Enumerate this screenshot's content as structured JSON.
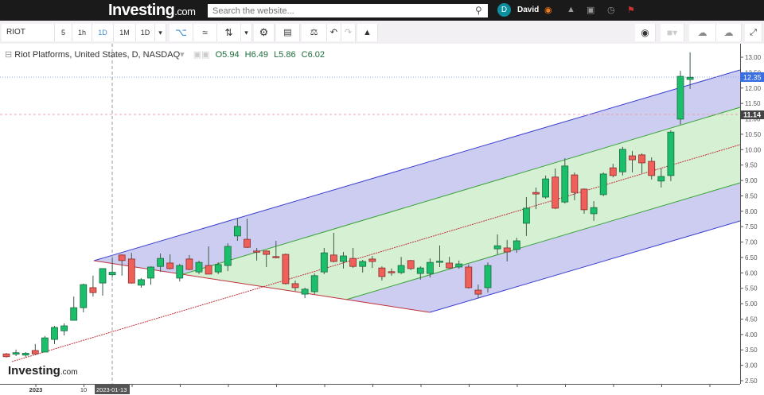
{
  "header": {
    "logo": "Investing",
    "logo_suffix": ".com",
    "search_placeholder": "Search the website...",
    "user_initial": "D",
    "user_name": "David"
  },
  "toolbar": {
    "symbol": "RIOT",
    "intervals": [
      "5",
      "1h",
      "1D",
      "1M",
      "1D"
    ],
    "active_interval": "1D"
  },
  "legend": {
    "title": "Riot Platforms, United States, D, NASDAQ",
    "open": "O5.94",
    "high": "H6.49",
    "low": "L5.86",
    "close": "C6.02"
  },
  "watermark": {
    "logo": "Investing",
    "suffix": ".com"
  },
  "colors": {
    "up": "#1bbf6b",
    "down": "#f0605a",
    "blue_band": "#c7c8ee",
    "green_band": "#d6f0d3",
    "last_price": "#3a6fe0"
  },
  "chart_data": {
    "type": "candlestick",
    "title": "Riot Platforms, United States, D, NASDAQ",
    "ylim": [
      2.5,
      13.0
    ],
    "y_ticks": [
      "13.00",
      "12.50",
      "12.00",
      "11.50",
      "11.00",
      "10.50",
      "10.00",
      "9.50",
      "9.00",
      "8.50",
      "8.00",
      "7.50",
      "7.00",
      "6.50",
      "6.00",
      "5.50",
      "5.00",
      "4.50",
      "4.00",
      "3.50",
      "3.00",
      "2.50"
    ],
    "x_labels": [
      "2023",
      "10"
    ],
    "crosshair_date": "2023-01-13",
    "last_price_label": "12.35",
    "marker_price_label": "11.14",
    "ohlc": [
      [
        3.37,
        3.4,
        3.25,
        3.28
      ],
      [
        3.36,
        3.51,
        3.3,
        3.41
      ],
      [
        3.33,
        3.43,
        3.27,
        3.39
      ],
      [
        3.48,
        3.69,
        3.33,
        3.37
      ],
      [
        3.43,
        3.95,
        3.43,
        3.89
      ],
      [
        3.84,
        4.28,
        3.69,
        4.23
      ],
      [
        4.12,
        4.36,
        3.97,
        4.28
      ],
      [
        4.46,
        5.23,
        4.46,
        4.87
      ],
      [
        4.87,
        5.65,
        4.72,
        5.62
      ],
      [
        5.52,
        5.91,
        5.23,
        5.36
      ],
      [
        5.67,
        6.14,
        5.26,
        6.14
      ],
      [
        5.94,
        6.49,
        5.86,
        6.02
      ],
      [
        6.58,
        6.6,
        5.91,
        6.4
      ],
      [
        6.45,
        6.65,
        5.65,
        5.67
      ],
      [
        5.6,
        5.83,
        5.52,
        5.78
      ],
      [
        5.83,
        6.21,
        5.62,
        6.19
      ],
      [
        6.21,
        6.63,
        6.03,
        6.47
      ],
      [
        6.32,
        6.6,
        6.11,
        6.14
      ],
      [
        5.83,
        6.29,
        5.72,
        6.24
      ],
      [
        6.45,
        6.58,
        6.09,
        6.11
      ],
      [
        6.03,
        6.4,
        5.96,
        6.34
      ],
      [
        6.24,
        6.86,
        5.96,
        5.96
      ],
      [
        6.03,
        6.34,
        5.96,
        6.27
      ],
      [
        6.24,
        6.96,
        6.06,
        6.86
      ],
      [
        7.2,
        7.76,
        7.04,
        7.51
      ],
      [
        7.09,
        7.76,
        6.81,
        6.83
      ],
      [
        6.71,
        6.81,
        6.4,
        6.7
      ],
      [
        6.71,
        6.73,
        6.19,
        6.6
      ],
      [
        6.53,
        7.04,
        6.47,
        6.52
      ],
      [
        6.6,
        6.63,
        5.62,
        5.65
      ],
      [
        5.65,
        5.75,
        5.41,
        5.52
      ],
      [
        5.31,
        5.52,
        5.18,
        5.47
      ],
      [
        5.39,
        5.98,
        5.31,
        5.91
      ],
      [
        6.03,
        6.81,
        5.96,
        6.65
      ],
      [
        6.58,
        7.3,
        6.34,
        6.37
      ],
      [
        6.37,
        6.68,
        6.14,
        6.55
      ],
      [
        6.47,
        6.81,
        6.16,
        6.21
      ],
      [
        6.21,
        6.42,
        6.01,
        6.37
      ],
      [
        6.45,
        6.55,
        6.16,
        6.37
      ],
      [
        6.16,
        6.21,
        5.75,
        5.88
      ],
      [
        6.04,
        6.14,
        5.91,
        6.01
      ],
      [
        6.01,
        6.52,
        5.96,
        6.24
      ],
      [
        6.4,
        6.42,
        6.09,
        6.14
      ],
      [
        5.98,
        6.21,
        5.78,
        6.16
      ],
      [
        5.98,
        6.47,
        5.85,
        6.34
      ],
      [
        6.37,
        6.89,
        6.19,
        6.38
      ],
      [
        6.32,
        6.52,
        6.14,
        6.16
      ],
      [
        6.19,
        6.4,
        6.14,
        6.29
      ],
      [
        6.19,
        6.27,
        5.49,
        5.52
      ],
      [
        5.44,
        5.62,
        5.18,
        5.31
      ],
      [
        5.52,
        6.34,
        5.36,
        6.24
      ],
      [
        6.78,
        7.25,
        6.6,
        6.88
      ],
      [
        6.81,
        7.07,
        6.37,
        6.68
      ],
      [
        6.76,
        7.14,
        6.65,
        7.04
      ],
      [
        7.61,
        8.46,
        7.2,
        8.1
      ],
      [
        8.61,
        8.77,
        8.07,
        8.56
      ],
      [
        8.46,
        9.16,
        8.41,
        9.05
      ],
      [
        9.11,
        9.39,
        8.07,
        8.1
      ],
      [
        8.3,
        9.72,
        8.25,
        9.47
      ],
      [
        9.18,
        9.26,
        8.36,
        8.61
      ],
      [
        8.72,
        8.74,
        7.92,
        8.05
      ],
      [
        7.92,
        8.33,
        7.69,
        8.12
      ],
      [
        8.54,
        9.26,
        8.49,
        9.21
      ],
      [
        9.41,
        9.54,
        9.1,
        9.16
      ],
      [
        9.28,
        10.09,
        9.16,
        10.01
      ],
      [
        9.8,
        9.96,
        9.26,
        9.67
      ],
      [
        9.83,
        9.88,
        9.23,
        9.57
      ],
      [
        9.62,
        9.75,
        9.03,
        9.16
      ],
      [
        8.98,
        9.39,
        8.77,
        9.13
      ],
      [
        9.16,
        10.63,
        8.98,
        10.57
      ],
      [
        10.99,
        12.56,
        10.81,
        12.38
      ],
      [
        12.28,
        13.16,
        11.97,
        12.35
      ]
    ]
  }
}
